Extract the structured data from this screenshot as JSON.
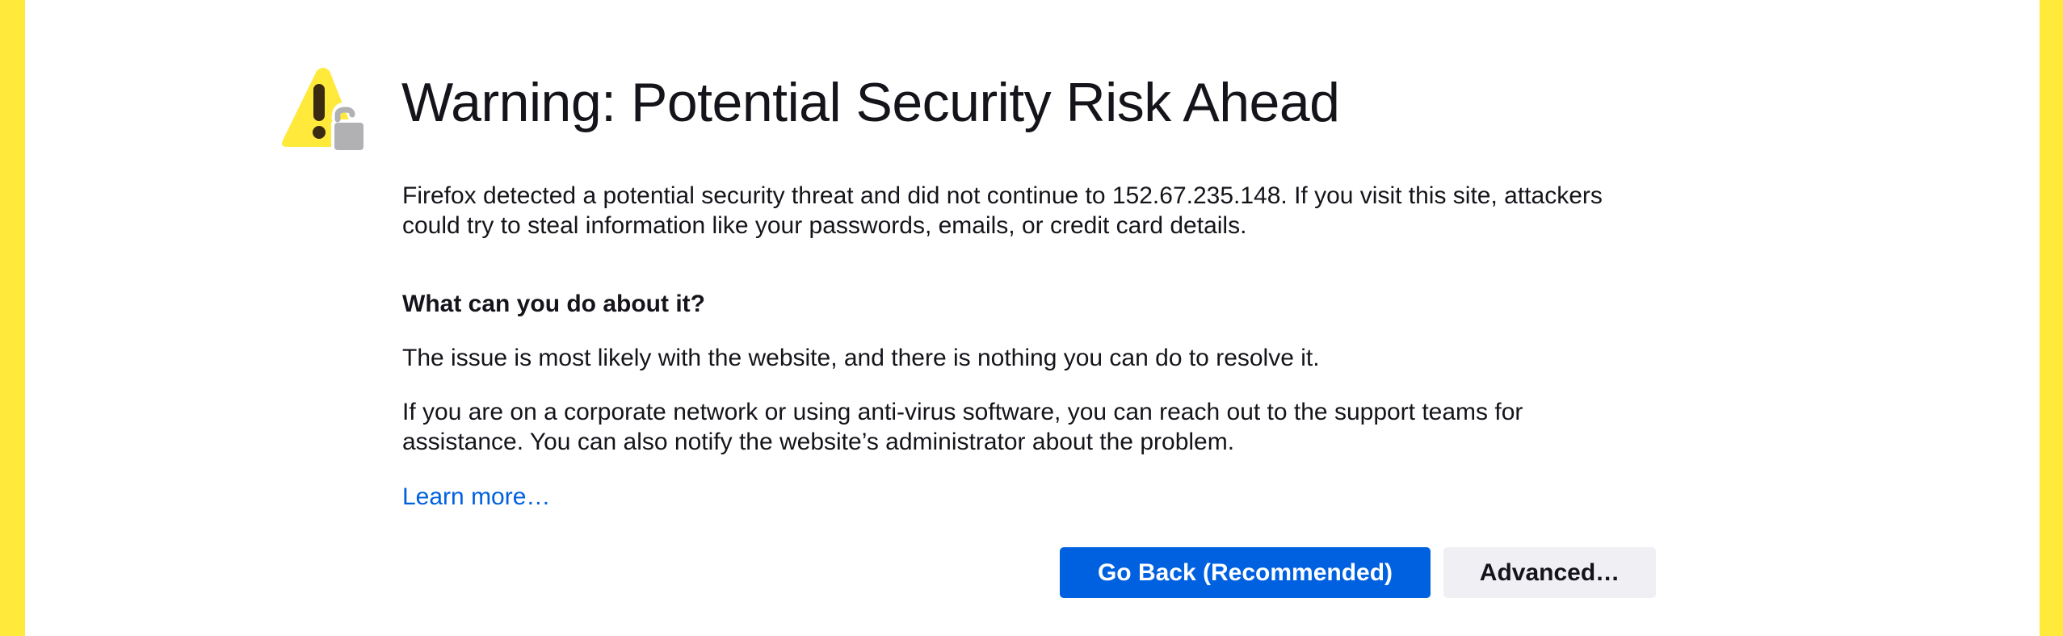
{
  "colors": {
    "frame_accent": "#ffe93b",
    "title_text": "#15141a",
    "link": "#0061e0",
    "primary_button": "#0061e0",
    "secondary_button": "#f0f0f4"
  },
  "icons": {
    "warning": "warning-triangle-icon",
    "lock": "broken-lock-icon"
  },
  "page": {
    "title": "Warning: Potential Security Risk Ahead",
    "intro": "Firefox detected a potential security threat and did not continue to 152.67.235.148. If you visit this site, attackers could try to steal information like your passwords, emails, or credit card details.",
    "subheading": "What can you do about it?",
    "paragraph_issue": "The issue is most likely with the website, and there is nothing you can do to resolve it.",
    "paragraph_corporate": "If you are on a corporate network or using anti-virus software, you can reach out to the support teams for assistance. You can also notify the website’s administrator about the problem.",
    "learn_more": "Learn more…"
  },
  "buttons": {
    "go_back": "Go Back (Recommended)",
    "advanced": "Advanced…"
  }
}
